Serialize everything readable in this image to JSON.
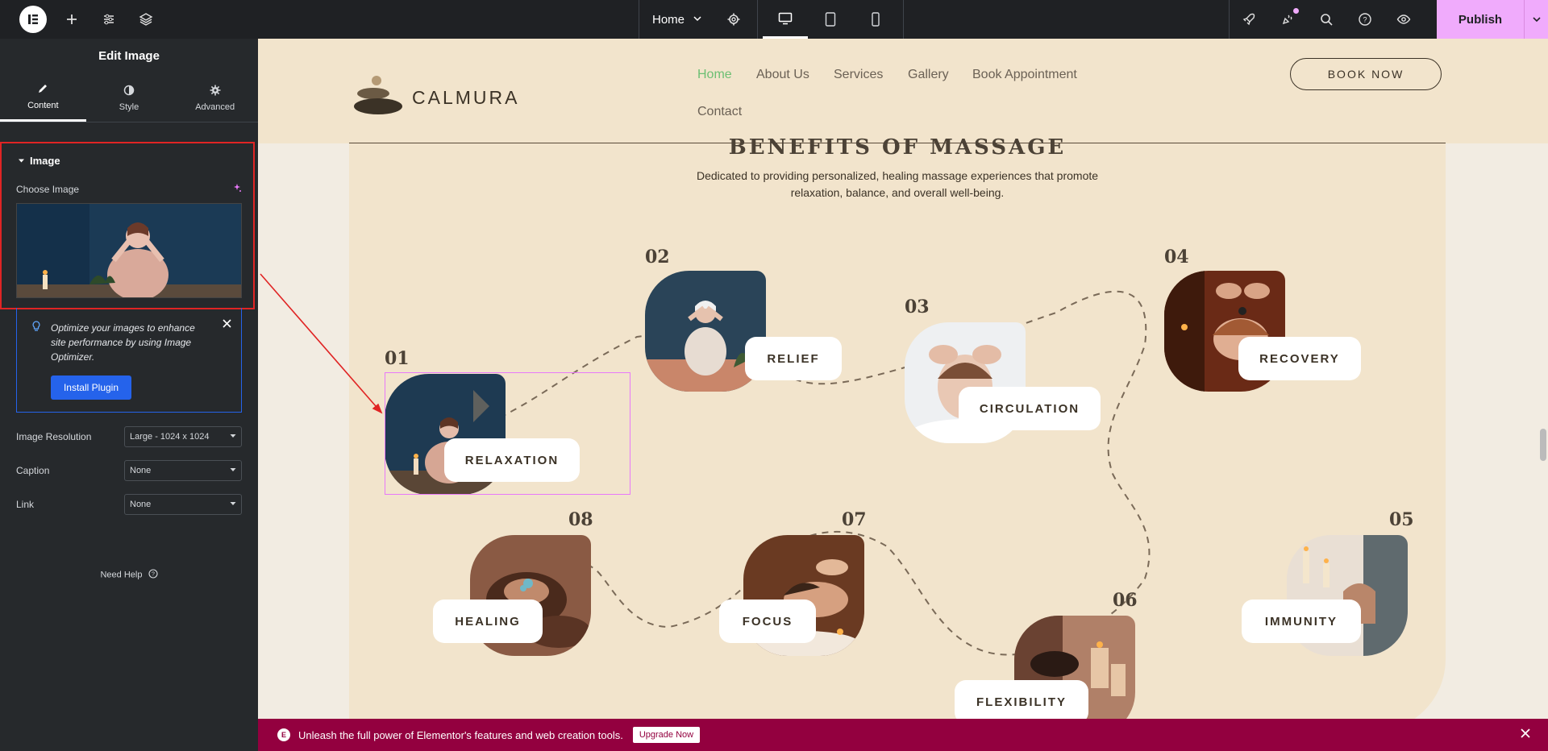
{
  "topbar": {
    "page_name": "Home",
    "publish_label": "Publish",
    "accent": "#f0abfc"
  },
  "sidebar": {
    "title": "Edit Image",
    "tabs": [
      {
        "label": "Content",
        "icon": "pencil-icon"
      },
      {
        "label": "Style",
        "icon": "half-circle-icon"
      },
      {
        "label": "Advanced",
        "icon": "gear-icon"
      }
    ],
    "section_title": "Image",
    "choose_image_label": "Choose Image",
    "notice": {
      "text": "Optimize your images to enhance site performance by using Image Optimizer.",
      "button": "Install Plugin"
    },
    "controls": [
      {
        "label": "Image Resolution",
        "value": "Large - 1024 x 1024"
      },
      {
        "label": "Caption",
        "value": "None"
      },
      {
        "label": "Link",
        "value": "None"
      }
    ],
    "need_help": "Need Help"
  },
  "site": {
    "brand": "CALMURA",
    "nav": [
      "Home",
      "About Us",
      "Services",
      "Gallery",
      "Book Appointment",
      "Contact"
    ],
    "active_nav": "Home",
    "active_color": "#6dbf73",
    "book_now": "BOOK NOW",
    "section_title": "BENEFITS OF MASSAGE",
    "section_subtitle": "Dedicated to providing personalized, healing massage experiences that promote relaxation, balance, and overall well-being.",
    "benefits": [
      {
        "num": "01",
        "label": "RELAXATION"
      },
      {
        "num": "02",
        "label": "RELIEF"
      },
      {
        "num": "03",
        "label": "CIRCULATION"
      },
      {
        "num": "04",
        "label": "RECOVERY"
      },
      {
        "num": "05",
        "label": "IMMUNITY"
      },
      {
        "num": "06",
        "label": "FLEXIBILITY"
      },
      {
        "num": "07",
        "label": "FOCUS"
      },
      {
        "num": "08",
        "label": "HEALING"
      }
    ]
  },
  "promo": {
    "text": "Unleash the full power of Elementor's features and web creation tools.",
    "button": "Upgrade Now",
    "background": "#93003f"
  }
}
